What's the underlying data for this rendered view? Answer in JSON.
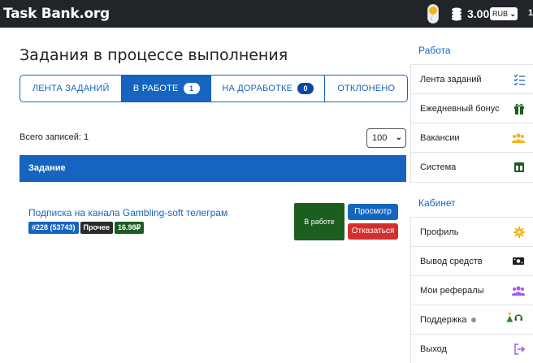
{
  "navbar": {
    "brand": "Task Bank.org",
    "balance": "3.00",
    "currency": "RUB",
    "extra": "1"
  },
  "main": {
    "title": "Задания в процессе выполнения",
    "tabs": [
      {
        "label": "ЛЕНТА ЗАДАНИЙ",
        "badge": null,
        "active": false
      },
      {
        "label": "В РАБОТЕ",
        "badge": "1",
        "active": true
      },
      {
        "label": "НА ДОРАБОТКЕ",
        "badge": "0",
        "active": false
      },
      {
        "label": "ОТКЛОНЕНО",
        "badge": null,
        "active": false
      }
    ],
    "records_label": "Всего записей: 1",
    "per_page": "100",
    "table_header": "Задание",
    "tasks": [
      {
        "title": "Подписка на канала Gambling-soft телеграм",
        "id_chip": "#228 (53743)",
        "category_chip": "Прочее",
        "price_chip": "16.98₽",
        "status": "В работе",
        "view_label": "Просмотр",
        "refuse_label": "Отказаться"
      }
    ]
  },
  "sidebar": {
    "work_title": "Работа",
    "work_items": [
      {
        "label": "Лента заданий",
        "icon": "checklist-icon"
      },
      {
        "label": "Ежедневный бонус",
        "icon": "gift-icon"
      },
      {
        "label": "Вакансии",
        "icon": "people-icon"
      },
      {
        "label": "Система",
        "icon": "layout-icon"
      }
    ],
    "cabinet_title": "Кабинет",
    "cabinet_items": [
      {
        "label": "Профиль",
        "icon": "gear-icon"
      },
      {
        "label": "Вывод средств",
        "icon": "cash-icon"
      },
      {
        "label": "Мои рефералы",
        "icon": "people-icon"
      },
      {
        "label": "Поддержка",
        "icon": "headset-icon"
      },
      {
        "label": "Выход",
        "icon": "logout-icon"
      }
    ]
  },
  "colors": {
    "primary": "#1565c0",
    "navbar": "#212529",
    "success": "#1b5e20",
    "danger": "#d32f2f",
    "gold": "#f6b21b",
    "purple": "#a855f7"
  }
}
